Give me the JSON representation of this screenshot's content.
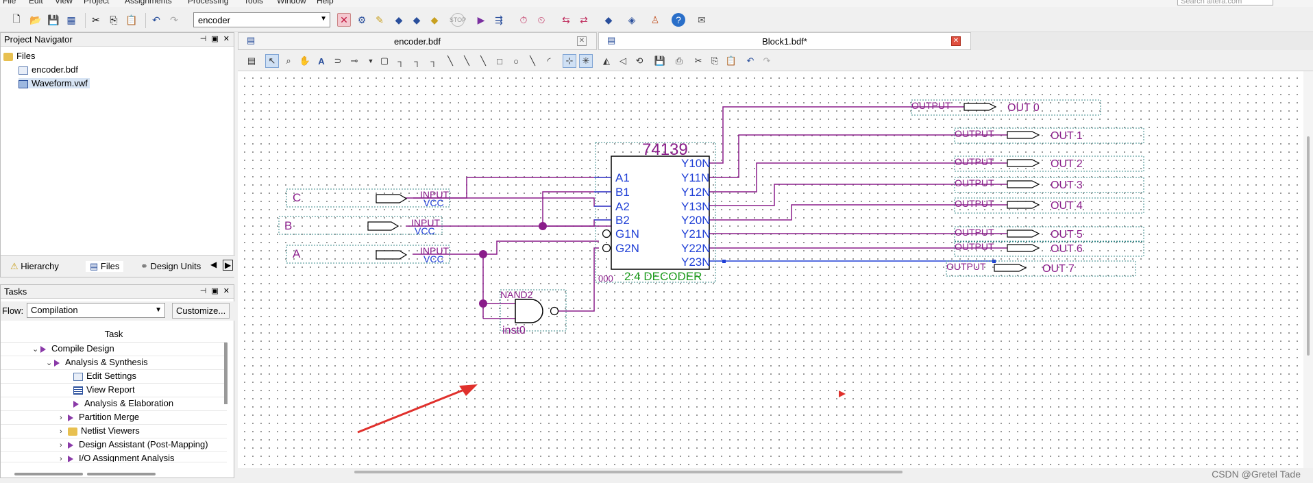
{
  "menu": {
    "items": [
      "File",
      "Edit",
      "View",
      "Project",
      "Assignments",
      "Processing",
      "Tools",
      "Window",
      "Help"
    ],
    "search_placeholder": "Search altera.com"
  },
  "toolbar": {
    "entity": "encoder"
  },
  "project_navigator": {
    "title": "Project Navigator",
    "tree": {
      "root": "Files",
      "files": [
        "encoder.bdf",
        "Waveform.vwf"
      ]
    },
    "tabs": [
      "Hierarchy",
      "Files",
      "Design Units"
    ]
  },
  "tasks": {
    "title": "Tasks",
    "flow_label": "Flow:",
    "flow_value": "Compilation",
    "customize_label": "Customize...",
    "column_header": "Task",
    "items": [
      "Compile Design",
      "Analysis & Synthesis",
      "Edit Settings",
      "View Report",
      "Analysis & Elaboration",
      "Partition Merge",
      "Netlist Viewers",
      "Design Assistant (Post-Mapping)",
      "I/O Assignment Analysis"
    ]
  },
  "documents": {
    "tabs": [
      {
        "label": "encoder.bdf"
      },
      {
        "label": "Block1.bdf*"
      }
    ]
  },
  "schematic": {
    "decoder": {
      "name": "74139",
      "inputs": [
        "A1",
        "B1",
        "A2",
        "B2",
        "G1N",
        "G2N"
      ],
      "outputs": [
        "Y10N",
        "Y11N",
        "Y12N",
        "Y13N",
        "Y20N",
        "Y21N",
        "Y22N",
        "Y23N"
      ],
      "caption": "2:4 DECODER",
      "inst": "000"
    },
    "inputs": [
      {
        "name": "C",
        "type": "INPUT",
        "vcc": "VCC"
      },
      {
        "name": "B",
        "type": "INPUT",
        "vcc": "VCC"
      },
      {
        "name": "A",
        "type": "INPUT",
        "vcc": "VCC"
      }
    ],
    "outputs": [
      {
        "name": "OUT 0",
        "type": "OUTPUT"
      },
      {
        "name": "OUT 1",
        "type": "OUTPUT"
      },
      {
        "name": "OUT 2",
        "type": "OUTPUT"
      },
      {
        "name": "OUT 3",
        "type": "OUTPUT"
      },
      {
        "name": "OUT 4",
        "type": "OUTPUT"
      },
      {
        "name": "OUT 5",
        "type": "OUTPUT"
      },
      {
        "name": "OUT 6",
        "type": "OUTPUT"
      },
      {
        "name": "OUT 7",
        "type": "OUTPUT"
      }
    ],
    "gate": {
      "name": "NAND2",
      "inst": "inst0"
    }
  },
  "watermark": "CSDN @Gretel Tade",
  "colors": {
    "wire": "#8a1d8a",
    "pin": "#1f3fd6",
    "label": "#8a1d8a",
    "caption": "#1a9a1a",
    "arrow": "#e0302c"
  }
}
